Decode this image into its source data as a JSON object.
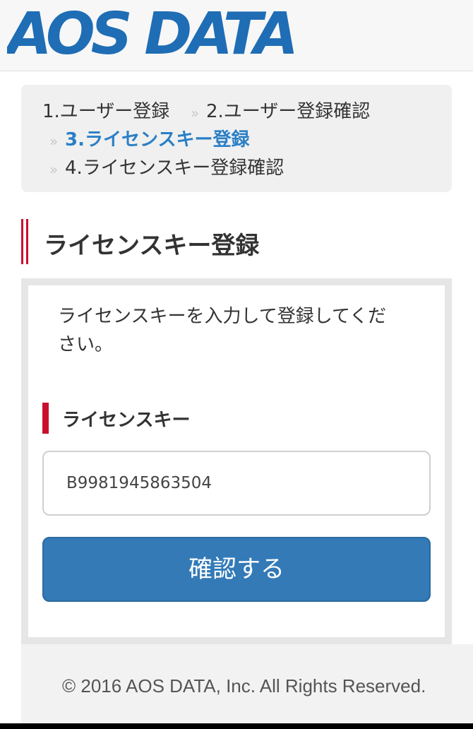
{
  "brand": {
    "logo_text": "AOS DATA",
    "logo_color": "#1f6db5"
  },
  "steps": [
    {
      "label": "1.ユーザー登録",
      "current": false
    },
    {
      "label": "2.ユーザー登録確認",
      "current": false
    },
    {
      "label": "3.ライセンスキー登録",
      "current": true
    },
    {
      "label": "4.ライセンスキー登録確認",
      "current": false
    }
  ],
  "step_separator": "»",
  "section": {
    "title": "ライセンスキー登録"
  },
  "form": {
    "instruction_line1": "ライセンスキーを入力して登録してくだ",
    "instruction_line2": "さい。",
    "license_label": "ライセンスキー",
    "license_value": "B9981945863504",
    "submit_label": "確認する"
  },
  "footer": {
    "copyright": "© 2016 AOS DATA, Inc. All Rights Reserved."
  },
  "colors": {
    "accent_blue": "#337ab7",
    "current_step": "#2a7fc6",
    "heading_red": "#c8102e"
  }
}
